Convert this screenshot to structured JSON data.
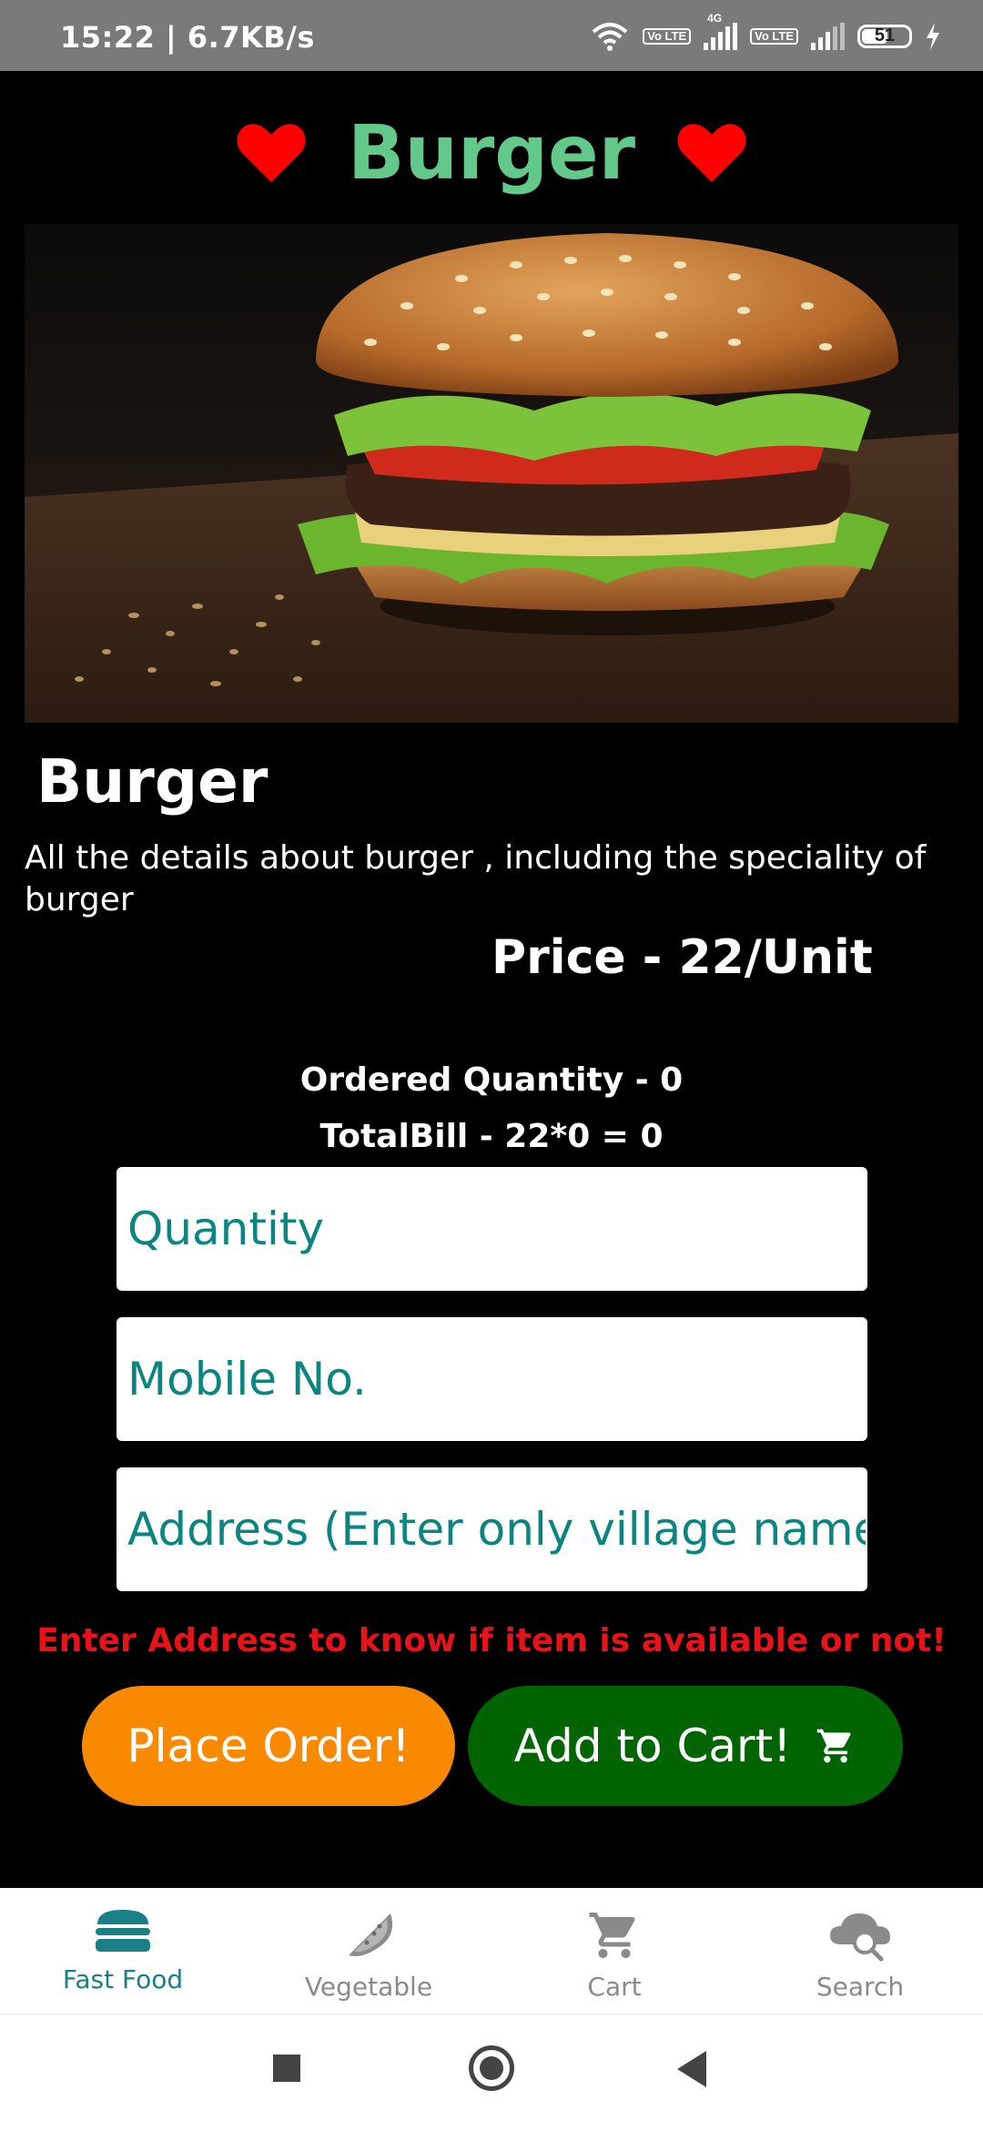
{
  "status_bar": {
    "time": "15:22 | 6.7KB/s",
    "network_4g": "4G",
    "lte_label": "Vo LTE",
    "battery": "51"
  },
  "header": {
    "title": "Burger",
    "heart_color": "#ff0000",
    "title_color": "#63c98b"
  },
  "item": {
    "name": "Burger",
    "description": "All the details about burger , including the speciality of burger",
    "price": "Price - 22/Unit",
    "ordered_quantity": "Ordered Quantity -  0",
    "total_bill": "TotalBill -  22*0 = 0"
  },
  "form": {
    "quantity_placeholder": "Quantity",
    "mobile_placeholder": "Mobile No.",
    "address_placeholder": "Address (Enter only village name!)",
    "warning": "Enter Address to know if item is available or not!"
  },
  "actions": {
    "place_order": "Place Order!",
    "add_to_cart": "Add to Cart!",
    "place_order_color": "#f98a00",
    "add_to_cart_color": "#006400"
  },
  "bottom_nav": {
    "items": [
      {
        "label": "Fast Food",
        "icon": "burger-icon",
        "active": true
      },
      {
        "label": "Vegetable",
        "icon": "watermelon-icon",
        "active": false
      },
      {
        "label": "Cart",
        "icon": "cart-icon",
        "active": false
      },
      {
        "label": "Search",
        "icon": "cloud-search-icon",
        "active": false
      }
    ]
  }
}
